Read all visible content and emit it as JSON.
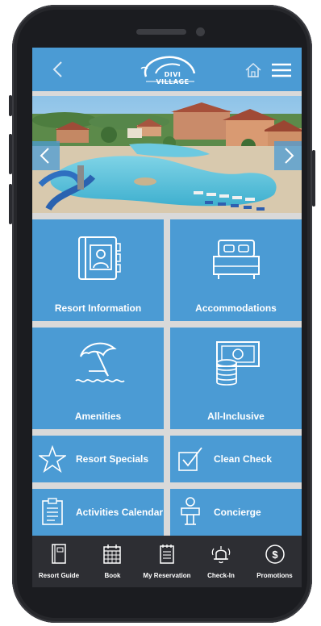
{
  "app": {
    "logo_text": "DIVI VILLAGE"
  },
  "tiles": {
    "resort_information": "Resort Information",
    "accommodations": "Accommodations",
    "amenities": "Amenities",
    "all_inclusive": "All-Inclusive",
    "resort_specials": "Resort Specials",
    "clean_check": "Clean Check",
    "activities_calendar": "Activities Calendar",
    "concierge": "Concierge"
  },
  "tabbar": {
    "items": [
      {
        "label": "Resort Guide",
        "icon": "book-icon"
      },
      {
        "label": "Book",
        "icon": "calendar-icon"
      },
      {
        "label": "My Reservation",
        "icon": "notepad-icon"
      },
      {
        "label": "Check-In",
        "icon": "bell-icon"
      },
      {
        "label": "Promotions",
        "icon": "dollar-icon"
      }
    ]
  },
  "colors": {
    "brand_blue": "#4b9bd4",
    "tabbar_dark": "#2d2e33",
    "phone_body": "#1b1c20"
  }
}
